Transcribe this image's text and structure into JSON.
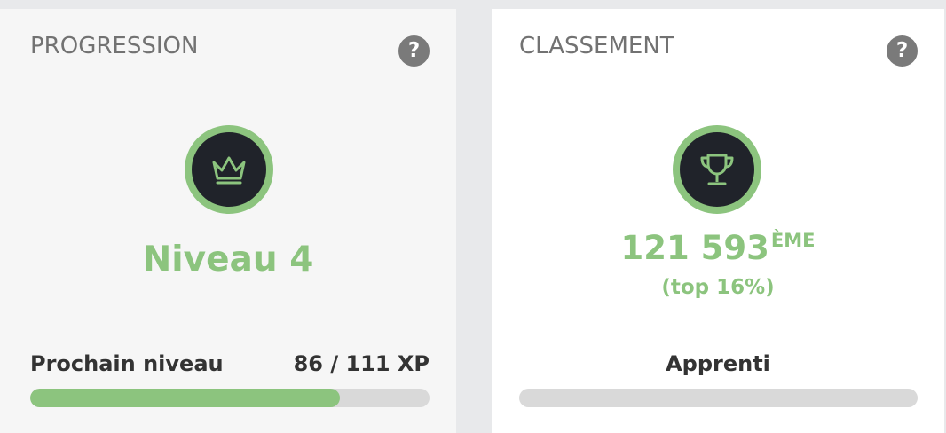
{
  "colors": {
    "accent_green": "#8cc47e",
    "badge_dark": "#20232a",
    "bar_track": "#d9d9d9",
    "help_icon_bg": "#7a7a7a"
  },
  "progression": {
    "title": "PROGRESSION",
    "help_icon": "?",
    "badge_icon": "crown-icon",
    "level": "Niveau 4",
    "next_level_label": "Prochain niveau",
    "xp": "86 / 111 XP",
    "progress_fraction": 0.7748
  },
  "classement": {
    "title": "CLASSEMENT",
    "help_icon": "?",
    "badge_icon": "trophy-icon",
    "rank_number": "121 593",
    "rank_suffix": "ÈME",
    "rank_top": "(top 16%)",
    "rank_title": "Apprenti",
    "progress_fraction": 0
  }
}
